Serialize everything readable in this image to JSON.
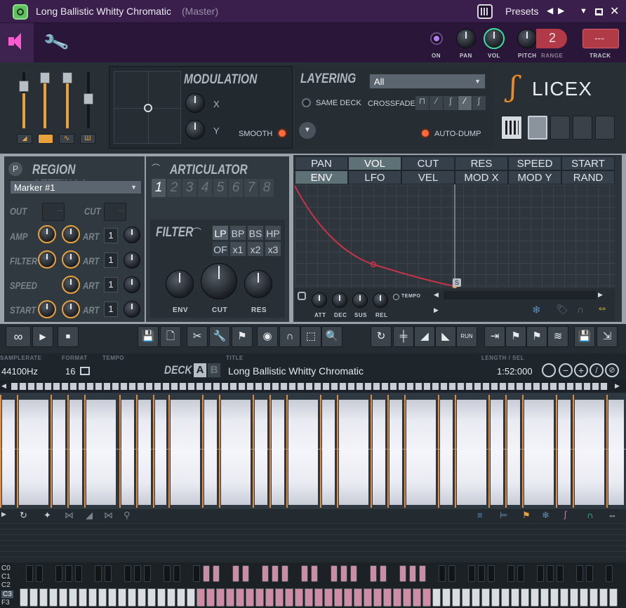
{
  "titlebar": {
    "title": "Long Ballistic Whitty Chromatic",
    "subtitle": "(Master)",
    "presets_label": "Presets"
  },
  "topbar": {
    "on_label": "ON",
    "pan_label": "PAN",
    "vol_label": "VOL",
    "pitch_label": "PITCH",
    "range_label": "RANGE",
    "range_value": "2",
    "track_label": "TRACK",
    "track_value": "---"
  },
  "modulation": {
    "title": "MODULATION",
    "x_label": "X",
    "y_label": "Y",
    "smooth_label": "SMOOTH"
  },
  "layering": {
    "title": "LAYERING",
    "dropdown_value": "All",
    "same_deck_label": "SAME DECK",
    "crossfade_label": "CROSSFADE",
    "auto_dump_label": "AUTO-DUMP"
  },
  "logo": {
    "text": "LICEX"
  },
  "region": {
    "title": "REGION SETTINGS",
    "marker_value": "Marker #1",
    "out_label": "OUT",
    "cut_label": "CUT",
    "rows": [
      {
        "label": "AMP",
        "art": "ART",
        "num": "1"
      },
      {
        "label": "FILTER",
        "art": "ART",
        "num": "1"
      },
      {
        "label": "SPEED",
        "art": "ART",
        "num": "1"
      },
      {
        "label": "START",
        "art": "ART",
        "num": "1"
      }
    ]
  },
  "articulator": {
    "title": "ARTICULATOR",
    "numbers": [
      "1",
      "2",
      "3",
      "4",
      "5",
      "6",
      "7",
      "8"
    ]
  },
  "filter": {
    "title": "FILTER",
    "types": [
      "LP",
      "BP",
      "BS",
      "HP"
    ],
    "of_label": "OF",
    "mults": [
      "x1",
      "x2",
      "x3"
    ],
    "env_label": "ENV",
    "cut_label": "CUT",
    "res_label": "RES"
  },
  "envelope_tabs": {
    "row1": [
      "PAN",
      "VOL",
      "CUT",
      "RES",
      "SPEED",
      "START"
    ],
    "row2": [
      "ENV",
      "LFO",
      "VEL",
      "MOD X",
      "MOD Y",
      "RAND"
    ],
    "active_row1": "VOL",
    "active_row2": "ENV"
  },
  "envelope_knobs": {
    "att": "ATT",
    "dec": "DEC",
    "sus": "SUS",
    "rel": "REL",
    "tempo": "TEMPO",
    "marker": "S"
  },
  "deck": {
    "samplerate_label": "SAMPLERATE",
    "samplerate_value": "44100Hz",
    "format_label": "FORMAT",
    "format_value": "16",
    "tempo_label": "TEMPO",
    "deck_label": "DECK",
    "deck_a": "A",
    "deck_b": "B",
    "title_label": "TITLE",
    "title_value": "Long Ballistic Whitty Chromatic",
    "length_label": "LENGTH / SEL",
    "length_value": "1:52:000"
  },
  "keyboard": {
    "octaves": [
      "C0",
      "C1",
      "C2",
      "C3",
      "F3"
    ]
  },
  "colors": {
    "accent_pink": "#cf8da5",
    "accent_orange": "#e38a3c",
    "envelope_red": "#c8324a",
    "title_bg": "#3a1f4d"
  }
}
